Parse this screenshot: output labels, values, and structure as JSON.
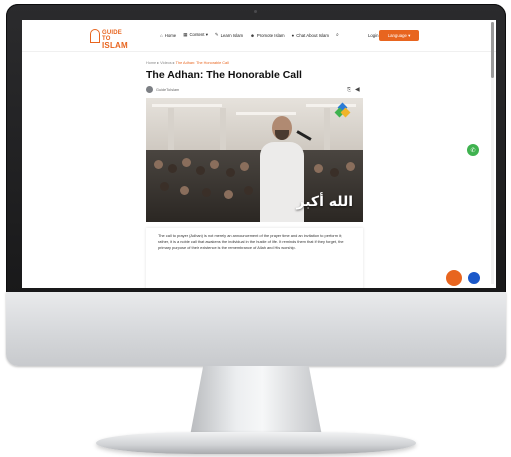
{
  "colors": {
    "accent": "#e8651f",
    "fab_green": "#3fb24f",
    "fab_blue": "#1b58c9"
  },
  "header": {
    "logo": {
      "line1": "GUIDE TO",
      "line2": "ISLAM"
    },
    "nav": [
      {
        "icon": "home-icon",
        "label": "Home"
      },
      {
        "icon": "grid-icon",
        "label": "Content ▾"
      },
      {
        "icon": "pencil-icon",
        "label": "Learn Islam"
      },
      {
        "icon": "group-icon",
        "label": "Promote Islam"
      },
      {
        "icon": "chat-icon",
        "label": "Chat About Islam"
      }
    ],
    "login_label": "Login",
    "language_label": "Language ▾"
  },
  "article": {
    "breadcrumb": {
      "home": "Home ▸",
      "section": "Videos ▸",
      "current": "The Adhan: The Honorable Call"
    },
    "title": "The Adhan: The Honorable Call",
    "author": "GuideToIslam",
    "video_caption": "الله أكبر",
    "body": "The call to prayer (Adhan) is not merely an announcement of the prayer time and an invitation to perform it; rather, it is a noble call that awakens the individual in the hustle of life. It reminds them that if they forget, the primary purpose of their existence is the remembrance of Allah and His worship."
  }
}
